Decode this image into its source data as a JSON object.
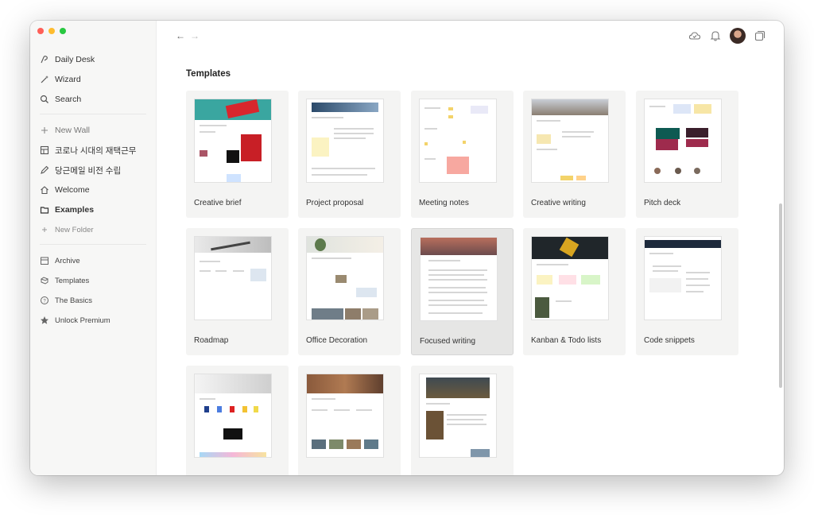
{
  "sidebar": {
    "top_items": [
      {
        "label": "Daily Desk",
        "icon": "desk-icon"
      },
      {
        "label": "Wizard",
        "icon": "wand-icon"
      },
      {
        "label": "Search",
        "icon": "search-icon"
      }
    ],
    "new_wall": "New Wall",
    "walls": [
      {
        "label": "코로나 시대의 재택근무",
        "icon": "layout-icon"
      },
      {
        "label": "당근메일 비전 수립",
        "icon": "pencil-icon"
      },
      {
        "label": "Welcome",
        "icon": "home-icon"
      }
    ],
    "examples": "Examples",
    "new_folder": "New Folder",
    "bottom_items": [
      {
        "label": "Archive",
        "icon": "archive-icon"
      },
      {
        "label": "Templates",
        "icon": "templates-icon"
      },
      {
        "label": "The Basics",
        "icon": "help-icon"
      },
      {
        "label": "Unlock Premium",
        "icon": "star-icon"
      }
    ]
  },
  "main": {
    "title": "Templates",
    "templates": [
      {
        "label": "Creative brief"
      },
      {
        "label": "Project proposal"
      },
      {
        "label": "Meeting notes"
      },
      {
        "label": "Creative writing"
      },
      {
        "label": "Pitch deck"
      },
      {
        "label": "Roadmap"
      },
      {
        "label": "Office Decoration"
      },
      {
        "label": "Focused writing",
        "selected": true
      },
      {
        "label": "Kanban & Todo lists"
      },
      {
        "label": "Code snippets"
      },
      {
        "label": ""
      },
      {
        "label": ""
      },
      {
        "label": ""
      }
    ]
  },
  "icons": {
    "back": "arrow-left-icon",
    "forward": "arrow-right-icon",
    "cloud": "cloud-check-icon",
    "bell": "bell-icon",
    "windows": "windows-icon"
  }
}
